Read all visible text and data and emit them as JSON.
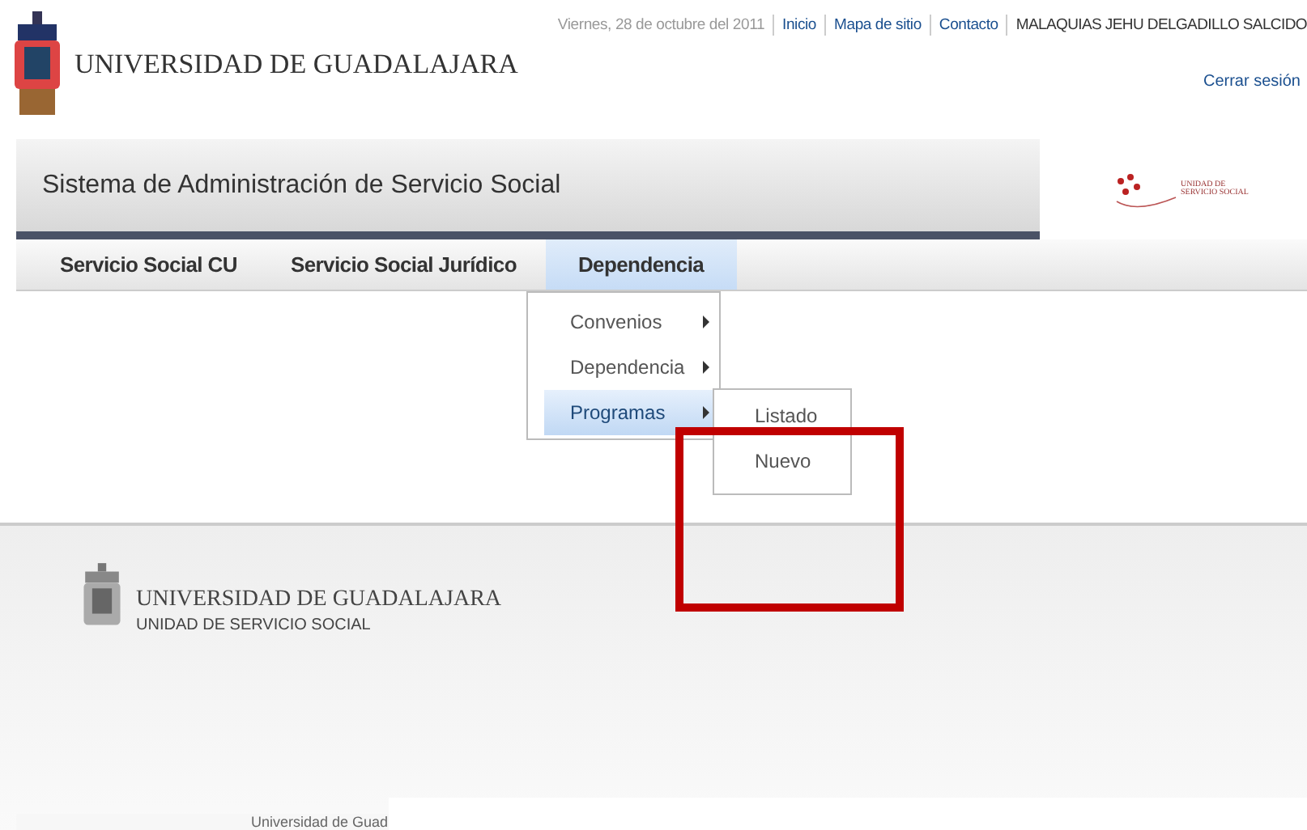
{
  "top_bar": {
    "date": "Viernes, 28 de octubre del 2011",
    "links": [
      "Inicio",
      "Mapa de sitio",
      "Contacto"
    ],
    "user": "MALAQUIAS JEHU DELGADILLO SALCIDO",
    "logout": "Cerrar sesión"
  },
  "header": {
    "university": "UNIVERSIDAD DE GUADALAJARA"
  },
  "title_bar": {
    "title": "Sistema de Administración de Servicio Social",
    "unit_logo_lines": [
      "UNIDAD DE",
      "SERVICIO SOCIAL"
    ]
  },
  "nav": [
    {
      "label": "Servicio Social CU",
      "selected": false
    },
    {
      "label": "Servicio Social Jurídico",
      "selected": false
    },
    {
      "label": "Dependencia",
      "selected": true
    }
  ],
  "dropdown": [
    {
      "label": "Convenios",
      "has_submenu": true,
      "selected": false
    },
    {
      "label": "Dependencia",
      "has_submenu": true,
      "selected": false
    },
    {
      "label": "Programas",
      "has_submenu": true,
      "selected": true
    }
  ],
  "submenu": [
    "Listado",
    "Nuevo"
  ],
  "footer": {
    "university": "UNIVERSIDAD DE GUADALAJARA",
    "unit": "UNIDAD DE SERVICIO SOCIAL",
    "copyright": "Universidad de Guad"
  }
}
